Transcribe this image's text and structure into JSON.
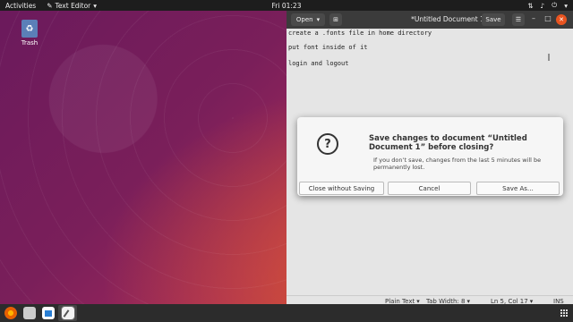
{
  "topbar": {
    "activities": "Activities",
    "app_menu": "Text Editor",
    "clock": "Fri 01:23"
  },
  "desktop": {
    "trash_label": "Trash"
  },
  "editor": {
    "open_label": "Open",
    "title": "*Untitled Document 1",
    "save_label": "Save",
    "lines": [
      "create a .fonts file in home directory",
      "put font inside of it",
      "login and logout"
    ],
    "status": {
      "language": "Plain Text",
      "tab_width": "Tab Width: 8",
      "position": "Ln 5, Col 17",
      "mode": "INS"
    }
  },
  "dialog": {
    "icon": "?",
    "title": "Save changes to document “Untitled Document 1” before closing?",
    "body": "If you don’t save, changes from the last 5 minutes will be permanently lost.",
    "buttons": {
      "close_without_saving": "Close without Saving",
      "cancel": "Cancel",
      "save_as": "Save As…"
    }
  },
  "dock": {
    "icons": [
      "firefox-icon",
      "files-icon",
      "writer-icon",
      "text-editor-icon",
      "show-apps-icon"
    ]
  },
  "colors": {
    "accent": "#e95420",
    "topbar": "#1d1d1d",
    "headerbar": "#3b3b3b"
  }
}
